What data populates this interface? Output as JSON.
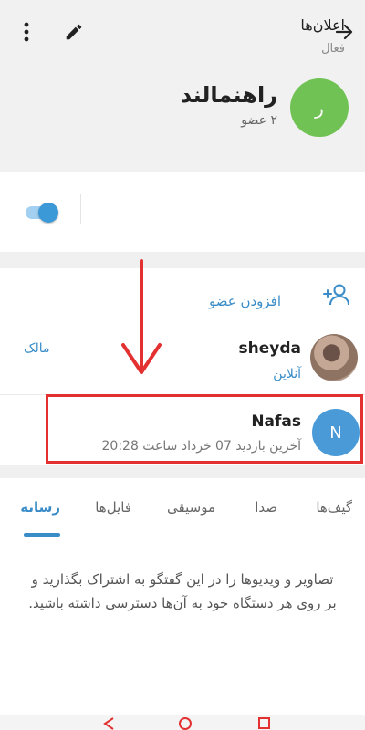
{
  "header": {
    "group_initial": "ر",
    "group_name": "راهنمالند",
    "member_count": "۲ عضو"
  },
  "notifications": {
    "label": "اعلان‌ها",
    "status": "فعال",
    "enabled": true
  },
  "members": {
    "add_label": "افزودن عضو",
    "list": [
      {
        "name": "sheyda",
        "status": "آنلاین",
        "role": "مالک"
      },
      {
        "name": "Nafas",
        "initial": "N",
        "status": "آخرین بازدید 07 خرداد ساعت 20:28"
      }
    ]
  },
  "media": {
    "tabs": [
      "گیف‌ها",
      "صدا",
      "موسیقی",
      "فایل‌ها",
      "رسانه"
    ],
    "active_tab": "رسانه",
    "empty_text": "تصاویر و ویدیوها را در این گفتگو به اشتراک بگذارید و بر روی هر دستگاه خود به آن‌ها دسترسی داشته باشید."
  },
  "colors": {
    "accent": "#3a8cc8",
    "group_avatar": "#71c254",
    "member_avatar": "#4a9ad8",
    "highlight": "#e33030"
  },
  "icons": [
    "more-vert-icon",
    "edit-icon",
    "arrow-forward-icon",
    "add-user-icon",
    "nav-back-icon",
    "nav-home-icon",
    "nav-recents-icon"
  ]
}
